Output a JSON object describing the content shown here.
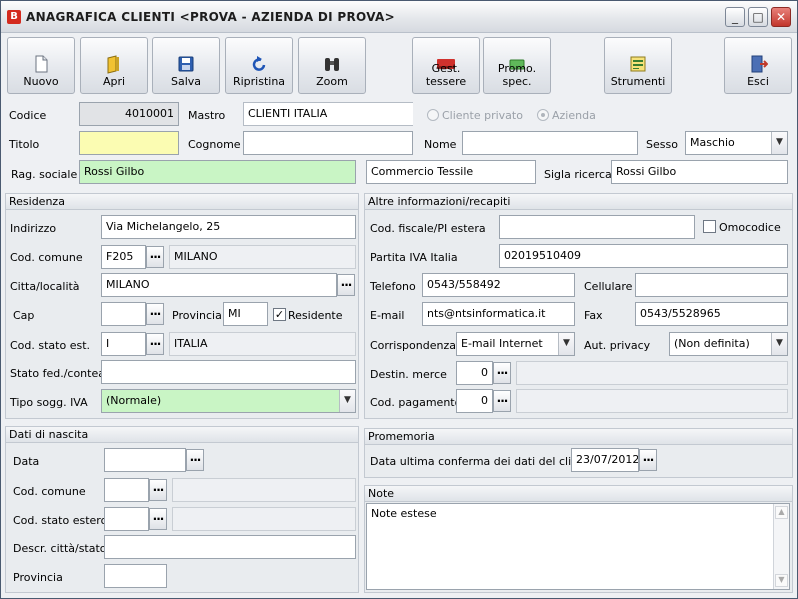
{
  "window": {
    "title": "ANAGRAFICA CLIENTI <PROVA - AZIENDA DI PROVA>",
    "app_icon_letter": "B",
    "minimize": "_",
    "maximize": "□",
    "close": "✕"
  },
  "toolbar": {
    "nuovo": "Nuovo",
    "apri": "Apri",
    "salva": "Salva",
    "ripristina": "Ripristina",
    "zoom": "Zoom",
    "gest_tessere": "Gest. tessere",
    "promo_spec": "Promo. spec.",
    "strumenti": "Strumenti",
    "esci": "Esci"
  },
  "header": {
    "codice_label": "Codice",
    "codice_value": "4010001",
    "mastro_label": "Mastro",
    "mastro_value": "CLIENTI ITALIA",
    "cliente_privato": "Cliente privato",
    "azienda": "Azienda",
    "titolo_label": "Titolo",
    "titolo_value": "",
    "cognome_label": "Cognome",
    "cognome_value": "",
    "nome_label": "Nome",
    "nome_value": "",
    "sesso_label": "Sesso",
    "sesso_value": "Maschio",
    "rag_sociale_label": "Rag. sociale",
    "rag_sociale_value": "Rossi Gilbo",
    "rag_sociale_2": "Commercio Tessile",
    "sigla_label": "Sigla ricerca",
    "sigla_value": "Rossi Gilbo"
  },
  "residenza": {
    "title": "Residenza",
    "indirizzo_label": "Indirizzo",
    "indirizzo_value": "Via Michelangelo, 25",
    "cod_comune_label": "Cod. comune",
    "cod_comune_value": "F205",
    "comune_name": "MILANO",
    "citta_label": "Citta/località",
    "citta_value": "MILANO",
    "cap_label": "Cap",
    "cap_value": "",
    "provincia_label": "Provincia",
    "provincia_value": "MI",
    "residente_label": "Residente",
    "residente_check": "✓",
    "cod_stato_label": "Cod. stato est.",
    "cod_stato_value": "I",
    "stato_name": "ITALIA",
    "stato_fed_label": "Stato fed./contea",
    "stato_fed_value": "",
    "tipo_iva_label": "Tipo sogg. IVA",
    "tipo_iva_value": "(Normale)"
  },
  "altre_info": {
    "title": "Altre informazioni/recapiti",
    "cod_fiscale_label": "Cod. fiscale/PI estera",
    "cod_fiscale_value": "",
    "omocodice_label": "Omocodice",
    "piva_label": "Partita IVA Italia",
    "piva_value": "02019510409",
    "telefono_label": "Telefono",
    "telefono_value": "0543/558492",
    "cellulare_label": "Cellulare",
    "cellulare_value": "",
    "email_label": "E-mail",
    "email_value": "nts@ntsinformatica.it",
    "fax_label": "Fax",
    "fax_value": "0543/5528965",
    "corrispondenza_label": "Corrispondenza",
    "corrispondenza_value": "E-mail Internet",
    "privacy_label": "Aut. privacy",
    "privacy_value": "(Non definita)",
    "destin_label": "Destin. merce",
    "destin_value": "0",
    "pagamento_label": "Cod. pagamento",
    "pagamento_value": "0"
  },
  "nascita": {
    "title": "Dati di nascita",
    "data_label": "Data",
    "data_value": "",
    "cod_comune_label": "Cod. comune",
    "cod_stato_label": "Cod. stato estero",
    "descr_label": "Descr. città/stato",
    "provincia_label": "Provincia"
  },
  "promemoria": {
    "title": "Promemoria",
    "conferma_label": "Data ultima conferma dei dati del cliente",
    "conferma_value": "23/07/2012"
  },
  "note": {
    "title": "Note",
    "value": "Note estese"
  },
  "glyphs": {
    "dots": "...",
    "dropdown": "▼",
    "scroll_up": "▲",
    "scroll_down": "▼"
  }
}
